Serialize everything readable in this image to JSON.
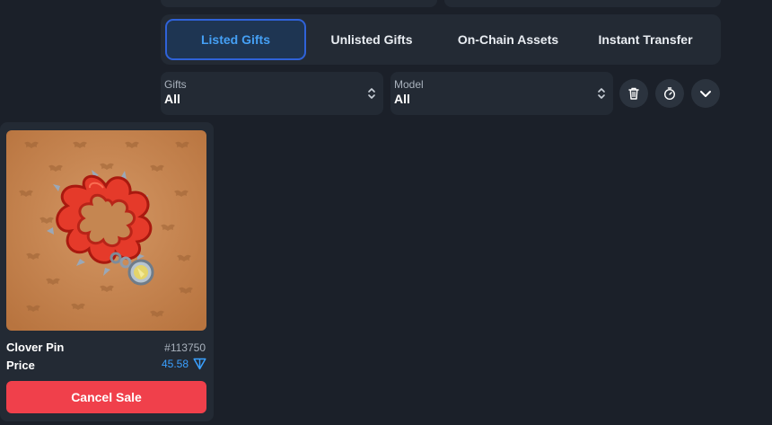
{
  "tabs": [
    {
      "label": "Listed Gifts",
      "active": true
    },
    {
      "label": "Unlisted Gifts",
      "active": false
    },
    {
      "label": "On-Chain Assets",
      "active": false
    },
    {
      "label": "Instant Transfer",
      "active": false
    }
  ],
  "filters": {
    "gifts": {
      "label": "Gifts",
      "value": "All"
    },
    "model": {
      "label": "Model",
      "value": "All"
    }
  },
  "actions": {
    "icons": [
      "trash-icon",
      "timer-icon",
      "chevron-down-icon"
    ]
  },
  "card": {
    "name": "Clover Pin",
    "number": "#113750",
    "price_label": "Price",
    "price": "45.58",
    "currency_icon": "ton-icon",
    "cancel_label": "Cancel Sale"
  },
  "colors": {
    "background": "#1b2029",
    "panel": "#232a34",
    "accent_blue": "#3aa0ff",
    "active_border": "#2f62d8",
    "danger": "#f0404b",
    "card_image_bg": "#c88a56"
  }
}
